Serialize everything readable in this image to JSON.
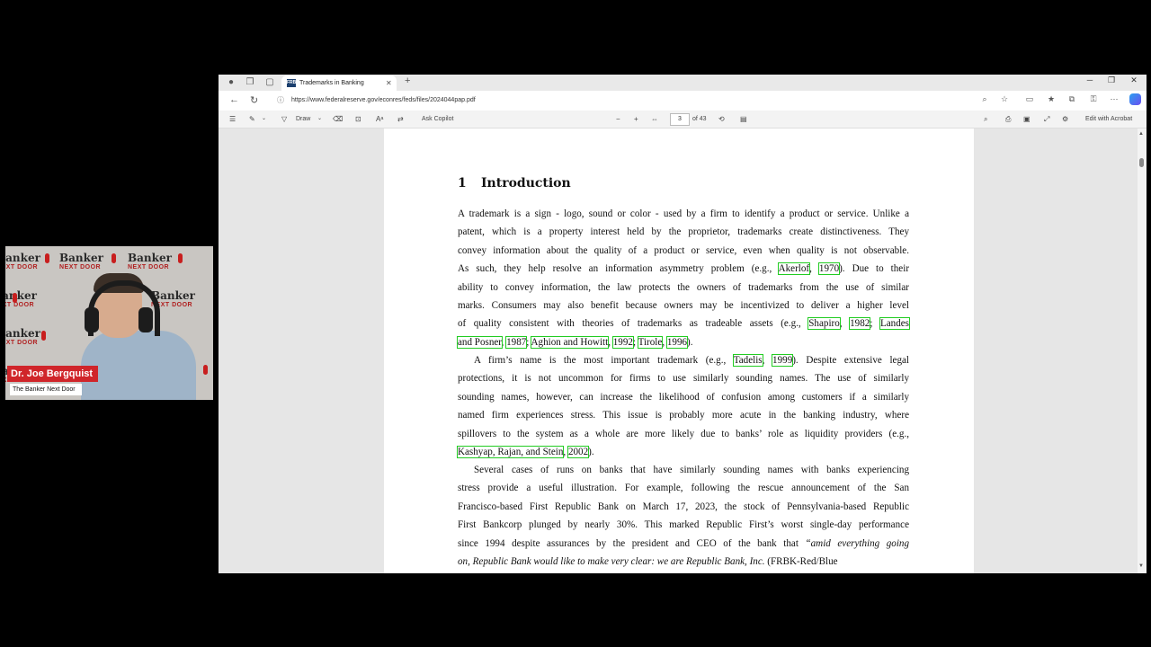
{
  "webcam": {
    "watermark_top": "Banker",
    "watermark_sub": "NEXT DOOR",
    "name": "Dr. Joe Bergquist",
    "subtitle": "The Banker Next Door"
  },
  "browser": {
    "tab_title": "Trademarks in Banking",
    "tab_favicon": "FRB",
    "url": "https://www.federalreserve.gov/econres/feds/files/2024044pap.pdf"
  },
  "pdf_toolbar": {
    "draw_label": "Draw",
    "ask_copilot": "Ask Copilot",
    "page_current": "3",
    "page_total": "of 43",
    "edit_acrobat": "Edit with Acrobat"
  },
  "document": {
    "section_number": "1",
    "section_title": "Introduction",
    "para1": [
      [
        "A trademark is a sign - logo, sound or color - used by a firm to identify a product or service. Unlike a"
      ],
      [
        "patent, which is a property interest held by the proprietor, trademarks create distinctiveness. They"
      ],
      [
        "convey information about the quality of a product or service, even when quality is not observable."
      ],
      [
        "As such, they help resolve an information asymmetry problem (e.g., ",
        {
          "c": "Akerlof"
        },
        ", ",
        {
          "c": "1970"
        },
        "). Due to their"
      ],
      [
        "ability to convey information, the law protects the owners of trademarks from the use of similar"
      ],
      [
        "marks. Consumers may also benefit because owners may be incentivized to deliver a higher level"
      ],
      [
        "of quality consistent with theories of trademarks as tradeable assets (e.g., ",
        {
          "c": "Shapiro"
        },
        ", ",
        {
          "c": "1982"
        },
        "; ",
        {
          "c": "Landes"
        }
      ],
      [
        {
          "c": "and Posner"
        },
        ", ",
        {
          "c": "1987"
        },
        "; ",
        {
          "c": "Aghion and Howitt"
        },
        ", ",
        {
          "c": "1992"
        },
        "; ",
        {
          "c": "Tirole"
        },
        ", ",
        {
          "c": "1996"
        },
        ")."
      ]
    ],
    "para2": [
      [
        "A firm’s name is the most important trademark (e.g., ",
        {
          "c": "Tadelis"
        },
        ", ",
        {
          "c": "1999"
        },
        "). Despite extensive legal"
      ],
      [
        "protections, it is not uncommon for firms to use similarly sounding names. The use of similarly"
      ],
      [
        "sounding names, however, can increase the likelihood of confusion among customers if a similarly"
      ],
      [
        "named firm experiences stress. This issue is probably more acute in the banking industry, where"
      ],
      [
        "spillovers to the system as a whole are more likely due to banks’ role as liquidity providers (e.g.,"
      ],
      [
        {
          "c": "Kashyap, Rajan, and Stein"
        },
        ", ",
        {
          "c": "2002"
        },
        ")."
      ]
    ],
    "para3": [
      [
        "Several cases of runs on banks that have similarly sounding names with banks experiencing"
      ],
      [
        "stress provide a useful illustration. For example, following the rescue announcement of the San"
      ],
      [
        "Francisco-based First Republic Bank on March 17, 2023, the stock of Pennsylvania-based Republic"
      ],
      [
        "First Bankcorp plunged by nearly 30%. This marked Republic First’s worst single-day performance"
      ],
      [
        "since 1994 despite assurances by the president and CEO of the bank that ",
        {
          "i": "“amid everything going"
        }
      ],
      [
        {
          "i": "on, Republic Bank would like to make very clear: we are Republic Bank, Inc."
        },
        " (FRBK-Red/Blue"
      ]
    ]
  }
}
